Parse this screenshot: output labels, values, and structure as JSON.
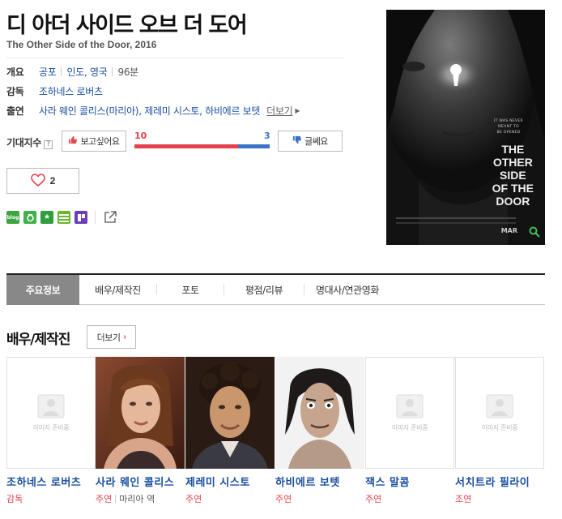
{
  "movie": {
    "title": "디 아더 사이드 오브 더 도어",
    "subtitle": "The Other Side of the Door, 2016"
  },
  "info": {
    "overview_label": "개요",
    "genre": "공포",
    "country": "인도, 영국",
    "runtime": "96분",
    "director_label": "감독",
    "director": "조하네스 로버츠",
    "cast_label": "출연",
    "cast_text": "사라 웨인 콜리스(마리아), 제레미 시스토, 하비에르 보텟",
    "cast_more": "더보기"
  },
  "expectation": {
    "label": "기대지수",
    "help": "?",
    "want_label": "보고싶어요",
    "dont_label": "글쎄요",
    "want_count": "10",
    "dont_count": "3",
    "want_ratio": 0.769
  },
  "like": {
    "count": "2"
  },
  "share": {
    "blog_label": "blog"
  },
  "poster": {
    "tagline_lines": [
      "IT WAS NEVER",
      "MEANT TO",
      "BE OPENED"
    ],
    "title_lines": [
      "THE",
      "OTHER",
      "SIDE",
      "OF THE",
      "DOOR"
    ],
    "release": "MAR"
  },
  "tabs": [
    {
      "label": "주요정보",
      "active": true
    },
    {
      "label": "배우/제작진",
      "active": false
    },
    {
      "label": "포토",
      "active": false
    },
    {
      "label": "평점/리뷰",
      "active": false
    },
    {
      "label": "명대사/연관영화",
      "active": false
    }
  ],
  "section": {
    "title": "배우/제작진",
    "more": "더보기"
  },
  "placeholder_text": "이미지 준비중",
  "cast_list": [
    {
      "name": "조하네스 로버츠",
      "role": "감독",
      "character": ""
    },
    {
      "name": "사라 웨인 콜리스",
      "role": "주연",
      "character": "마리아 역"
    },
    {
      "name": "제레미 시스토",
      "role": "주연",
      "character": ""
    },
    {
      "name": "하비에르 보텟",
      "role": "주연",
      "character": ""
    },
    {
      "name": "잭스 말콤",
      "role": "주연",
      "character": ""
    },
    {
      "name": "서치트라 필라이",
      "role": "조연",
      "character": ""
    }
  ],
  "colors": {
    "accent_red": "#e8414b",
    "link_blue": "#1a4fa0",
    "dislike_blue": "#3b73c7"
  }
}
